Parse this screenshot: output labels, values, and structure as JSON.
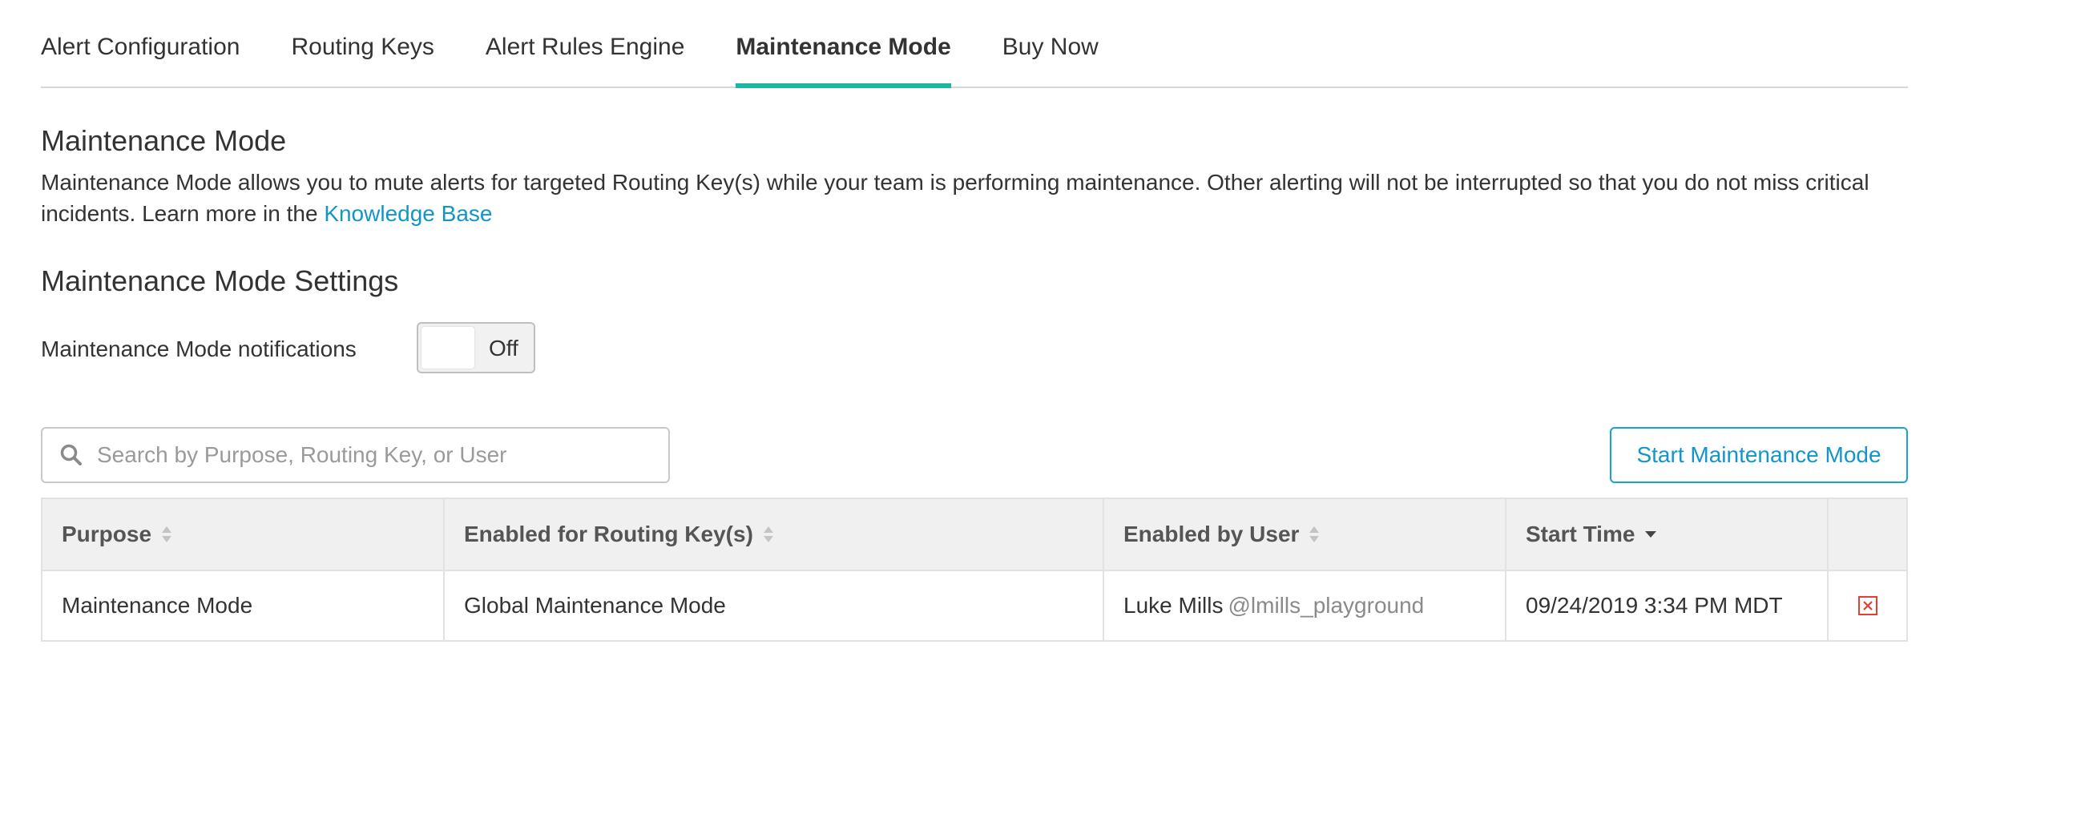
{
  "tabs": [
    {
      "label": "Alert Configuration",
      "active": false
    },
    {
      "label": "Routing Keys",
      "active": false
    },
    {
      "label": "Alert Rules Engine",
      "active": false
    },
    {
      "label": "Maintenance Mode",
      "active": true
    },
    {
      "label": "Buy Now",
      "active": false
    }
  ],
  "section": {
    "title": "Maintenance Mode",
    "description": "Maintenance Mode allows you to mute alerts for targeted Routing Key(s) while your team is performing maintenance. Other alerting will not be interrupted so that you do not miss critical incidents. Learn more in the ",
    "link_text": "Knowledge Base"
  },
  "settings": {
    "title": "Maintenance Mode Settings",
    "notifications_label": "Maintenance Mode notifications",
    "toggle_state": "Off"
  },
  "search": {
    "placeholder": "Search by Purpose, Routing Key, or User",
    "value": "",
    "icon": "search-icon"
  },
  "start_button": {
    "label": "Start Maintenance Mode"
  },
  "table": {
    "columns": [
      {
        "label": "Purpose",
        "sort": "none"
      },
      {
        "label": "Enabled for Routing Key(s)",
        "sort": "none"
      },
      {
        "label": "Enabled by User",
        "sort": "none"
      },
      {
        "label": "Start Time",
        "sort": "desc"
      },
      {
        "label": "",
        "sort": "none"
      }
    ],
    "rows": [
      {
        "purpose": "Maintenance Mode",
        "routing_keys": "Global Maintenance Mode",
        "user_name": "Luke Mills",
        "user_handle": "@lmills_playground",
        "start_time": "09/24/2019 3:34 PM MDT",
        "action_icon": "close-box-icon"
      }
    ]
  },
  "colors": {
    "accent_tab": "#1bb7a4",
    "link": "#1296c9",
    "button_border": "#1aa0d8",
    "delete": "#e0422f"
  }
}
